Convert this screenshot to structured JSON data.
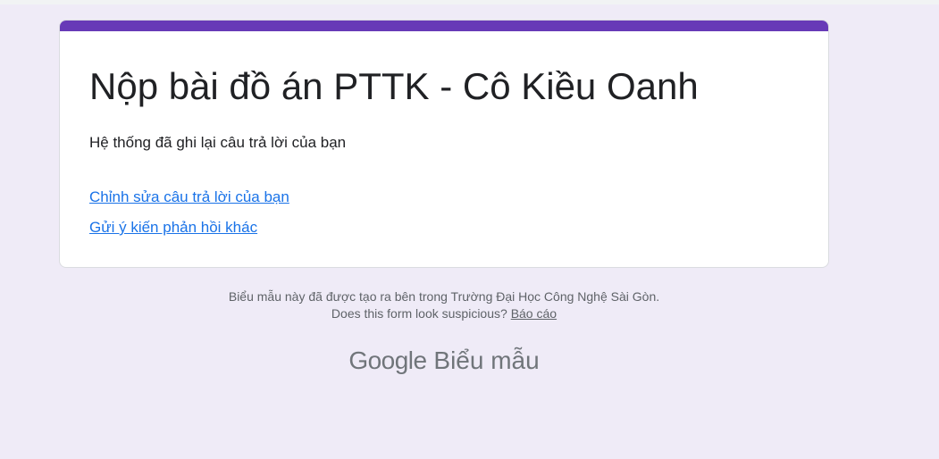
{
  "form": {
    "title": "Nộp bài đồ án PTTK - Cô Kiều Oanh",
    "confirmation": "Hệ thống đã ghi lại câu trả lời của bạn",
    "edit_link": "Chỉnh sửa câu trả lời của bạn",
    "another_link": "Gửi ý kiến phản hồi khác"
  },
  "footer": {
    "created_in": "Biểu mẫu này đã được tạo ra bên trong Trường Đại Học Công Nghệ Sài Gòn.",
    "suspicious": "Does this form look suspicious?",
    "report": "Báo cáo"
  },
  "brand": {
    "google": "Google",
    "product": "Biểu mẫu"
  },
  "colors": {
    "accent": "#673ab7",
    "background": "#efebf7",
    "link": "#1a73e8"
  }
}
